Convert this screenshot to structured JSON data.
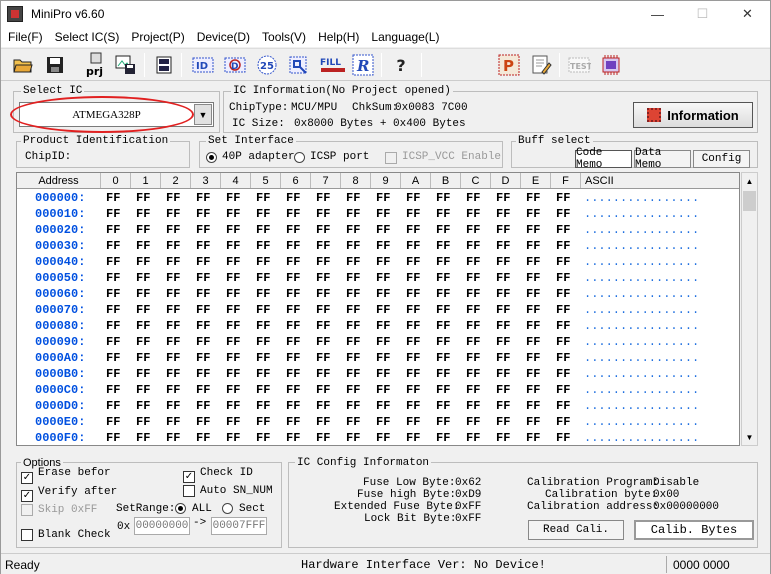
{
  "window": {
    "title": "MiniPro v6.60"
  },
  "menu": [
    "File(F)",
    "Select IC(S)",
    "Project(P)",
    "Device(D)",
    "Tools(V)",
    "Help(H)",
    "Language(L)"
  ],
  "toolbar_icons": [
    "open-folder",
    "save",
    "project-prj",
    "image-save",
    "device-chip",
    "id-tool",
    "verify-tool",
    "25-spi-tool",
    "hex-tool",
    "fill-tool",
    "read-r-tool",
    "help",
    "program-p",
    "edit-tool",
    "test-tool",
    "chip-settings"
  ],
  "select_ic": {
    "label": "Select IC",
    "value": "ATMEGA328P"
  },
  "ic_info": {
    "label": "IC Information(No Project opened)",
    "chip_type_label": "ChipType:",
    "chip_type": "MCU/MPU",
    "chksum_label": "ChkSum:",
    "chksum": "0x0083 7C00",
    "ic_size_label": "IC Size:",
    "ic_size": "0x8000 Bytes + 0x400 Bytes",
    "info_button": "Information"
  },
  "product_id": {
    "label": "Product Identification",
    "chipid_label": "ChipID:"
  },
  "interface": {
    "label": "Set Interface",
    "opt1": "40P adapter",
    "opt2": "ICSP port",
    "icsp_vcc": "ICSP_VCC Enable"
  },
  "buff": {
    "label": "Buff select",
    "code": "Code Memo",
    "data": "Data Memo",
    "config": "Config"
  },
  "grid": {
    "headers": [
      "Address",
      "0",
      "1",
      "2",
      "3",
      "4",
      "5",
      "6",
      "7",
      "8",
      "9",
      "A",
      "B",
      "C",
      "D",
      "E",
      "F",
      "ASCII"
    ],
    "rows": [
      {
        "addr": "000000:"
      },
      {
        "addr": "000010:"
      },
      {
        "addr": "000020:"
      },
      {
        "addr": "000030:"
      },
      {
        "addr": "000040:"
      },
      {
        "addr": "000050:"
      },
      {
        "addr": "000060:"
      },
      {
        "addr": "000070:"
      },
      {
        "addr": "000080:"
      },
      {
        "addr": "000090:"
      },
      {
        "addr": "0000A0:"
      },
      {
        "addr": "0000B0:"
      },
      {
        "addr": "0000C0:"
      },
      {
        "addr": "0000D0:"
      },
      {
        "addr": "0000E0:"
      },
      {
        "addr": "0000F0:"
      }
    ],
    "byte": "FF",
    "ascii": "................"
  },
  "options": {
    "label": "Options",
    "erase": "Erase befor",
    "verify": "Verify after",
    "skip": "Skip 0xFF",
    "blank": "Blank Check",
    "check_id": "Check ID",
    "auto_sn": "Auto SN_NUM",
    "setrange": "SetRange:",
    "all": "ALL",
    "sect": "Sect",
    "ox": "0x",
    "from": "00000000",
    "arrow": "->",
    "to": "00007FFF"
  },
  "ic_config": {
    "label": "IC Config Informaton",
    "fuse_low_label": "Fuse Low Byte:",
    "fuse_low": "0x62",
    "fuse_high_label": "Fuse high Byte:",
    "fuse_high": "0xD9",
    "ext_fuse_label": "Extended Fuse Byte:",
    "ext_fuse": "0xFF",
    "lock_label": "Lock Bit Byte:",
    "lock": "0xFF",
    "cal_prog_label": "Calibration Program:",
    "cal_prog": "Disable",
    "cal_byte_label": "Calibration byte:",
    "cal_byte": "0x00",
    "cal_addr_label": "Calibration address:",
    "cal_addr": "0x00000000",
    "read_cali": "Read Cali.",
    "calib_bytes": "Calib. Bytes"
  },
  "status": {
    "ready": "Ready",
    "hw": "Hardware Interface Ver: No Device!",
    "code": "0000 0000"
  }
}
